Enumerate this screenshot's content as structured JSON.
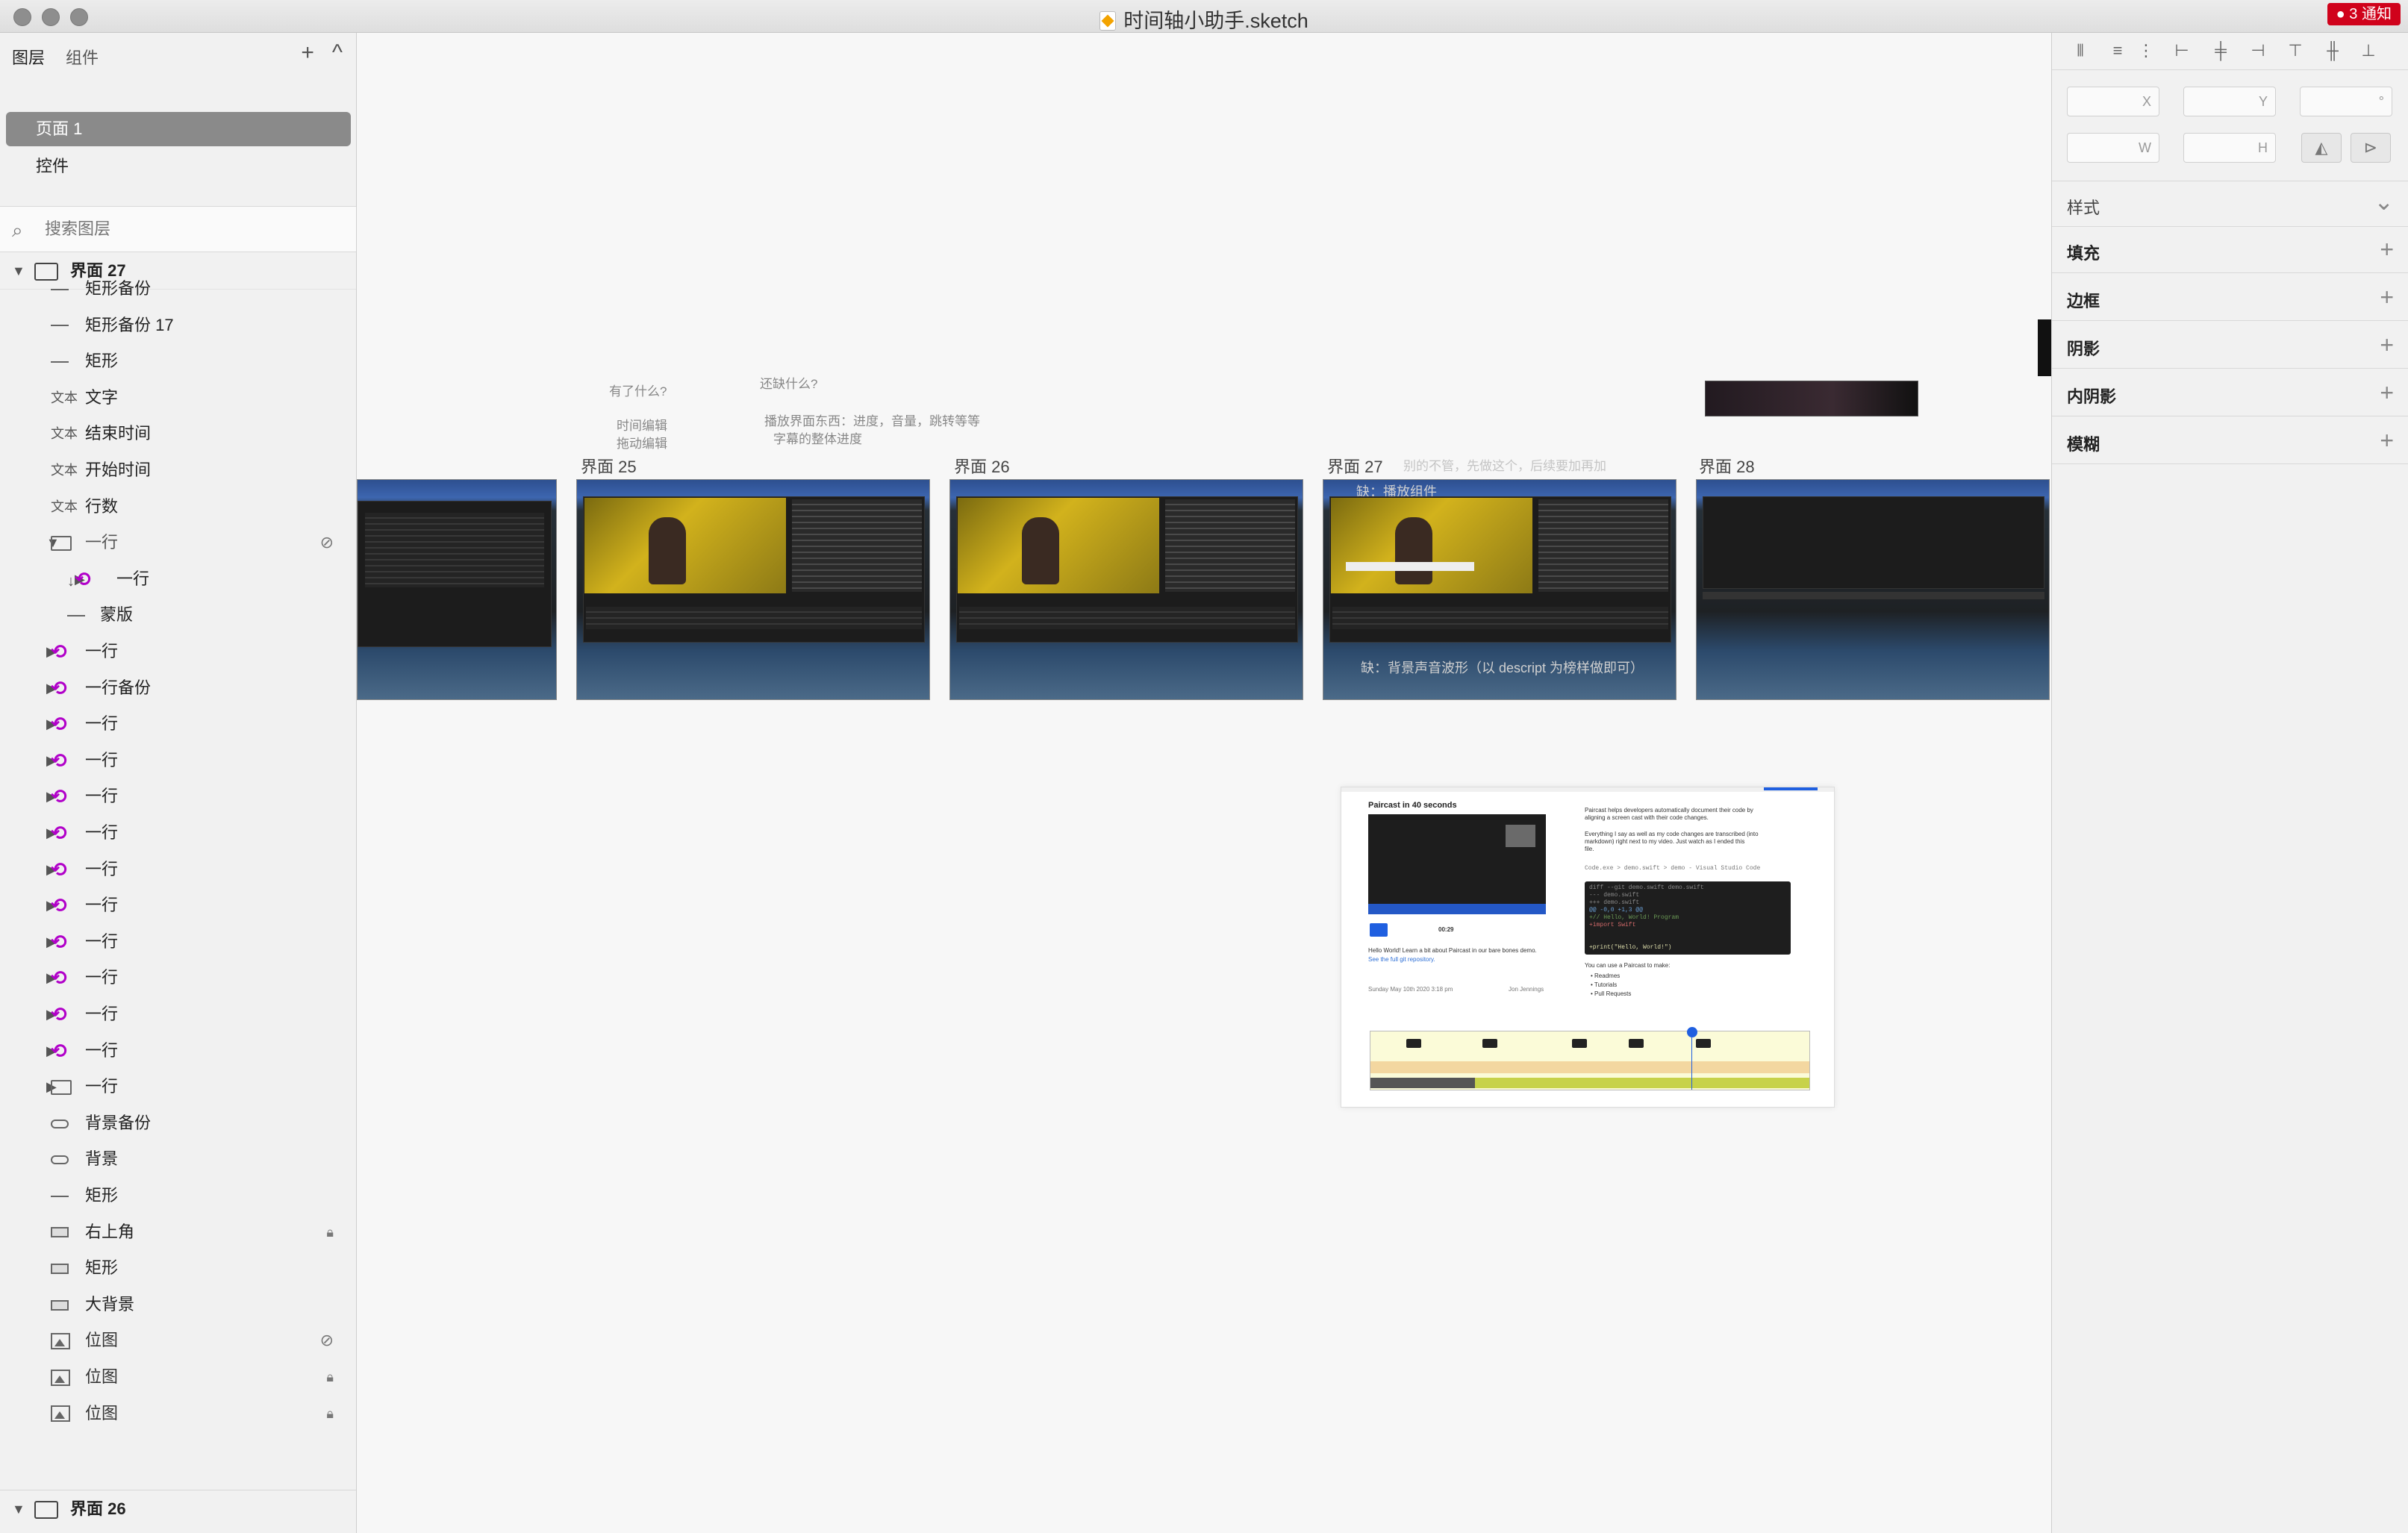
{
  "window": {
    "title": "时间轴小助手.sketch",
    "notifications": "● 3 通知"
  },
  "left_panel": {
    "tabs": [
      "图层",
      "组件"
    ],
    "add_glyph": "+",
    "collapse_glyph": "^",
    "pages": [
      "页面 1",
      "控件"
    ],
    "search_placeholder": "搜索图层",
    "layers": [
      {
        "label": "界面 27",
        "kind": "artboard",
        "indent": 0,
        "tri": "▼"
      },
      {
        "label": "矩形备份",
        "kind": "line",
        "indent": 1
      },
      {
        "label": "矩形备份 17",
        "kind": "line",
        "indent": 1
      },
      {
        "label": "矩形",
        "kind": "line",
        "indent": 1
      },
      {
        "label": "文字",
        "kind": "text",
        "indent": 1
      },
      {
        "label": "结束时间",
        "kind": "text",
        "indent": 1
      },
      {
        "label": "开始时间",
        "kind": "text",
        "indent": 1
      },
      {
        "label": "行数",
        "kind": "text",
        "indent": 1
      },
      {
        "label": "一行",
        "kind": "folder",
        "indent": 1,
        "tri": "▼",
        "hidden": true
      },
      {
        "label": "一行",
        "kind": "symbol-masked",
        "indent": 2,
        "tri": "▶"
      },
      {
        "label": "蒙版",
        "kind": "line",
        "indent": 2
      },
      {
        "label": "一行",
        "kind": "symbol",
        "indent": 1,
        "tri": "▶"
      },
      {
        "label": "一行备份",
        "kind": "symbol",
        "indent": 1,
        "tri": "▶"
      },
      {
        "label": "一行",
        "kind": "symbol",
        "indent": 1,
        "tri": "▶"
      },
      {
        "label": "一行",
        "kind": "symbol",
        "indent": 1,
        "tri": "▶"
      },
      {
        "label": "一行",
        "kind": "symbol",
        "indent": 1,
        "tri": "▶"
      },
      {
        "label": "一行",
        "kind": "symbol",
        "indent": 1,
        "tri": "▶"
      },
      {
        "label": "一行",
        "kind": "symbol",
        "indent": 1,
        "tri": "▶"
      },
      {
        "label": "一行",
        "kind": "symbol",
        "indent": 1,
        "tri": "▶"
      },
      {
        "label": "一行",
        "kind": "symbol",
        "indent": 1,
        "tri": "▶"
      },
      {
        "label": "一行",
        "kind": "symbol",
        "indent": 1,
        "tri": "▶"
      },
      {
        "label": "一行",
        "kind": "symbol",
        "indent": 1,
        "tri": "▶"
      },
      {
        "label": "一行",
        "kind": "symbol",
        "indent": 1,
        "tri": "▶"
      },
      {
        "label": "一行",
        "kind": "folder",
        "indent": 1,
        "tri": "▶"
      },
      {
        "label": "背景备份",
        "kind": "pill",
        "indent": 1
      },
      {
        "label": "背景",
        "kind": "pill",
        "indent": 1
      },
      {
        "label": "矩形",
        "kind": "line",
        "indent": 1
      },
      {
        "label": "右上角",
        "kind": "rect",
        "indent": 1,
        "locked": true
      },
      {
        "label": "矩形",
        "kind": "rect",
        "indent": 1
      },
      {
        "label": "大背景",
        "kind": "rect",
        "indent": 1
      },
      {
        "label": "位图",
        "kind": "image",
        "indent": 1,
        "hidden": true
      },
      {
        "label": "位图",
        "kind": "image",
        "indent": 1,
        "locked": true
      },
      {
        "label": "位图",
        "kind": "image",
        "indent": 1,
        "locked": true
      },
      {
        "label": "界面 26",
        "kind": "artboard",
        "indent": 0,
        "tri": "▼"
      }
    ],
    "text_kind_label": "文本"
  },
  "canvas": {
    "notes": {
      "have": "有了什么?",
      "time_edit": "时间编辑",
      "drag_edit": "拖动编辑",
      "missing": "还缺什么?",
      "player_items": "播放界面东西：进度，音量，跳转等等",
      "subtitle_progress": "字幕的整体进度",
      "dont_care": "别的不管，先做这个，后续要加再加",
      "missing_player": "缺：播放组件",
      "missing_waveform": "缺：背景声音波形（以 descript 为榜样做即可）"
    },
    "artboards": [
      "界面 25",
      "界面 26",
      "界面 27",
      "界面 28"
    ],
    "doc_preview": {
      "title": "Paircast in 40 seconds",
      "p1": "Paircast helps developers automatically document their code by",
      "p1b": "aligning a screen cast with their code changes.",
      "p2": "Everything I say as well as my code changes are transcribed (into",
      "p2b": "markdown) right next to my video. Just watch as I ended this",
      "p2c": "file.",
      "path": "Code.exe > demo.swift > demo - Visual Studio Code",
      "code_lines": [
        "diff --git demo.swift demo.swift",
        "--- demo.swift",
        "+++ demo.swift",
        "@@ -0,0 +1,3 @@",
        "+// Hello, World! Program",
        "+import Swift",
        "",
        "+print(\"Hello, World!\")"
      ],
      "use_for": "You can use a Paircast to make:",
      "bullets": [
        "• Readmes",
        "• Tutorials",
        "• Pull Requests"
      ],
      "hello": "Hello World! Learn a bit about Paircast in our bare bones demo.",
      "see": "See the full git repository.",
      "time": "00:29",
      "date": "Sunday May 10th 2020 3:18 pm",
      "author": "Jon Jennings"
    }
  },
  "inspector": {
    "align_icons": [
      "⫴",
      "≡",
      "⋮",
      "⊢",
      "╪",
      "⊣",
      "⊤",
      "╫",
      "⊥"
    ],
    "field_x": "X",
    "field_y": "Y",
    "field_rot": "°",
    "field_w": "W",
    "field_h": "H",
    "style_label": "样式",
    "style_chevron": "⌄",
    "sections": [
      "填充",
      "边框",
      "阴影",
      "内阴影",
      "模糊"
    ],
    "add_glyph": "+"
  },
  "colors": {
    "selected_page": "#8a8a8a",
    "symbol": "#b100c9",
    "notification": "#d0021b"
  }
}
